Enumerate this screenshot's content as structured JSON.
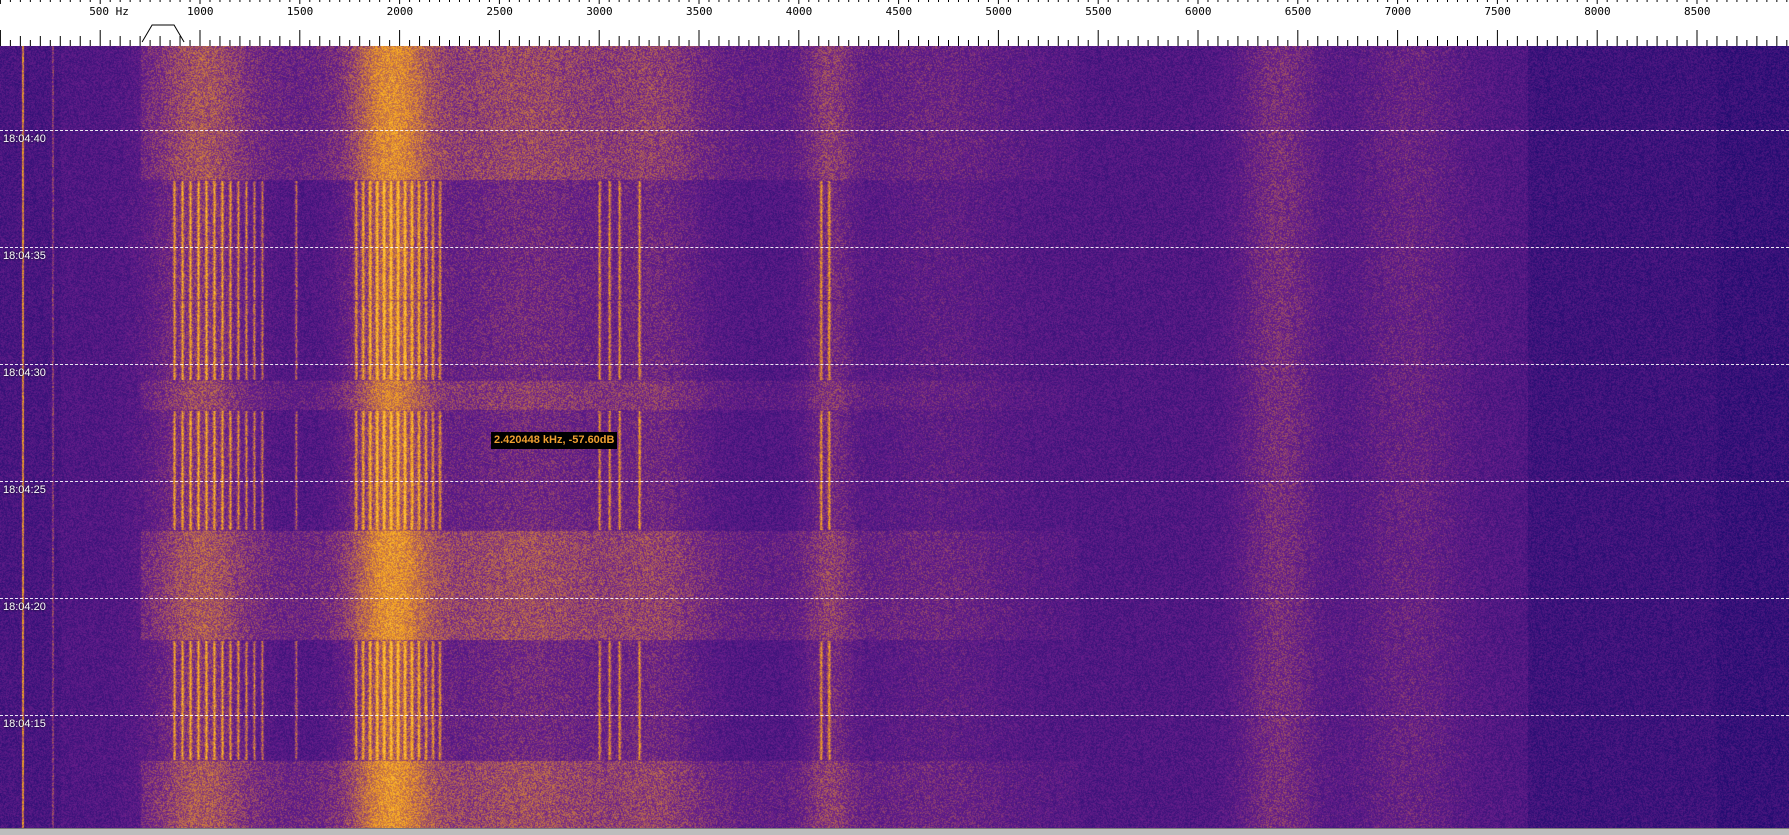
{
  "scale": {
    "labels": [
      {
        "hz": 500,
        "text": "500 Hz"
      },
      {
        "hz": 1000,
        "text": "1000"
      },
      {
        "hz": 1500,
        "text": "1500"
      },
      {
        "hz": 2000,
        "text": "2000"
      },
      {
        "hz": 2500,
        "text": "2500"
      },
      {
        "hz": 3000,
        "text": "3000"
      },
      {
        "hz": 3500,
        "text": "3500"
      },
      {
        "hz": 4000,
        "text": "4000"
      },
      {
        "hz": 4500,
        "text": "4500"
      },
      {
        "hz": 5000,
        "text": "5000"
      },
      {
        "hz": 5500,
        "text": "5500"
      },
      {
        "hz": 6000,
        "text": "6000"
      },
      {
        "hz": 6500,
        "text": "6500"
      },
      {
        "hz": 7000,
        "text": "7000"
      },
      {
        "hz": 7500,
        "text": "7500"
      },
      {
        "hz": 8000,
        "text": "8000"
      },
      {
        "hz": 8500,
        "text": "8500"
      }
    ],
    "passband_hz": [
      760,
      870
    ]
  },
  "waterfall": {
    "time_marks": [
      "18:04:40",
      "18:04:35",
      "18:04:30",
      "18:04:25",
      "18:04:20",
      "18:04:15"
    ],
    "colors": {
      "low": "#1a0a6e",
      "mid": "#6a1f8c",
      "high": "#f5a020"
    }
  },
  "tooltip": {
    "text": "2.420448 kHz, -57.60dB"
  }
}
